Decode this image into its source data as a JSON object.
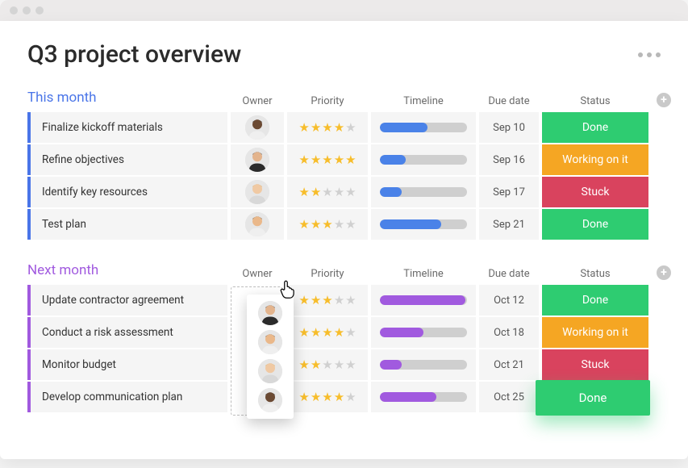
{
  "page_title": "Q3 project overview",
  "columns": {
    "owner": "Owner",
    "priority": "Priority",
    "timeline": "Timeline",
    "due": "Due date",
    "status": "Status"
  },
  "status_labels": {
    "done": "Done",
    "working": "Working on it",
    "stuck": "Stuck"
  },
  "groups": [
    {
      "id": "this_month",
      "title": "This month",
      "color": "blue",
      "drag_demo": false,
      "rows": [
        {
          "name": "Finalize kickoff materials",
          "avatar": "a1",
          "stars": 4,
          "timeline_pct": 55,
          "due": "Sep 10",
          "status": "done"
        },
        {
          "name": "Refine objectives",
          "avatar": "a2",
          "stars": 5,
          "timeline_pct": 30,
          "due": "Sep 16",
          "status": "working"
        },
        {
          "name": "Identify key resources",
          "avatar": "a3",
          "stars": 2,
          "timeline_pct": 25,
          "due": "Sep 17",
          "status": "stuck"
        },
        {
          "name": "Test plan",
          "avatar": "a4",
          "stars": 3,
          "timeline_pct": 70,
          "due": "Sep 21",
          "status": "done"
        }
      ]
    },
    {
      "id": "next_month",
      "title": "Next month",
      "color": "purple",
      "drag_demo": true,
      "rows": [
        {
          "name": "Update contractor agreement",
          "avatar": "a2",
          "stars": 3,
          "timeline_pct": 98,
          "due": "Oct 12",
          "status": "done"
        },
        {
          "name": "Conduct a risk assessment",
          "avatar": "a4",
          "stars": 4,
          "timeline_pct": 50,
          "due": "Oct 18",
          "status": "working"
        },
        {
          "name": "Monitor budget",
          "avatar": "a3",
          "stars": 2,
          "timeline_pct": 25,
          "due": "Oct 21",
          "status": "stuck"
        },
        {
          "name": "Develop communication plan",
          "avatar": "a1",
          "stars": 4,
          "timeline_pct": 65,
          "due": "Oct 25",
          "status": "done"
        }
      ]
    }
  ],
  "floating_done_label": "Done",
  "avatars": {
    "a1": {
      "skin": "#6b4a33",
      "hair": "#1d1d1d",
      "shirt": "#efefef"
    },
    "a2": {
      "skin": "#e3b48d",
      "hair": "#2b2b2b",
      "shirt": "#2b2b2b"
    },
    "a3": {
      "skin": "#f0c9a3",
      "hair": "#d8a24a",
      "shirt": "#d8d8d8"
    },
    "a4": {
      "skin": "#eab88a",
      "hair": "#5a3a22",
      "shirt": "#efefef"
    }
  }
}
